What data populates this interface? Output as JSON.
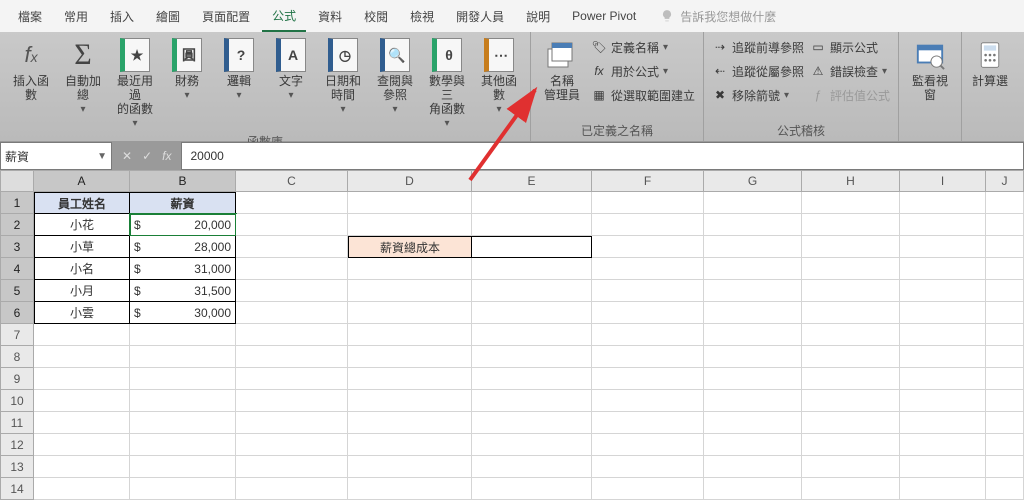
{
  "tabs": {
    "file": "檔案",
    "home": "常用",
    "insert": "插入",
    "draw": "繪圖",
    "layout": "頁面配置",
    "formulas": "公式",
    "data": "資料",
    "review": "校閱",
    "view": "檢視",
    "developer": "開發人員",
    "help": "說明",
    "powerpivot": "Power Pivot",
    "tellme": "告訴我您想做什麼"
  },
  "ribbon": {
    "insert_function": "插入函數",
    "autosum": "自動加總",
    "recent": "最近用過\n的函數",
    "financial": "財務",
    "logical": "邏輯",
    "text": "文字",
    "datetime": "日期和\n時間",
    "lookup": "查閱與\n參照",
    "math": "數學與三\n角函數",
    "more": "其他函數",
    "group_library": "函數庫",
    "name_manager": "名稱\n管理員",
    "define_name": "定義名稱",
    "use_in_formula": "用於公式",
    "from_selection": "從選取範圍建立",
    "group_names": "已定義之名稱",
    "trace_precedents": "追蹤前導參照",
    "trace_dependents": "追蹤從屬參照",
    "remove_arrows": "移除箭號",
    "show_formulas": "顯示公式",
    "error_check": "錯誤檢查",
    "evaluate": "評估值公式",
    "group_audit": "公式稽核",
    "watch_window": "監看視窗",
    "calc_options": "計算選"
  },
  "namebox": {
    "value": "薪資"
  },
  "formula_bar": {
    "value": "20000"
  },
  "columns": [
    "A",
    "B",
    "C",
    "D",
    "E",
    "F",
    "G",
    "H",
    "I",
    "J"
  ],
  "rows_labels": [
    "1",
    "2",
    "3",
    "4",
    "5",
    "6",
    "7",
    "8",
    "9",
    "10",
    "11",
    "12",
    "13",
    "14"
  ],
  "table": {
    "hdr_name": "員工姓名",
    "hdr_salary": "薪資",
    "names": [
      "小花",
      "小草",
      "小名",
      "小月",
      "小雲"
    ],
    "salaries": [
      "20,000",
      "28,000",
      "31,000",
      "31,500",
      "30,000"
    ],
    "currency_symbol": "$"
  },
  "label_cell_D3": "薪資總成本",
  "chart_data": {
    "type": "table",
    "columns": [
      "員工姓名",
      "薪資"
    ],
    "rows": [
      [
        "小花",
        20000
      ],
      [
        "小草",
        28000
      ],
      [
        "小名",
        31000
      ],
      [
        "小月",
        31500
      ],
      [
        "小雲",
        30000
      ]
    ]
  }
}
